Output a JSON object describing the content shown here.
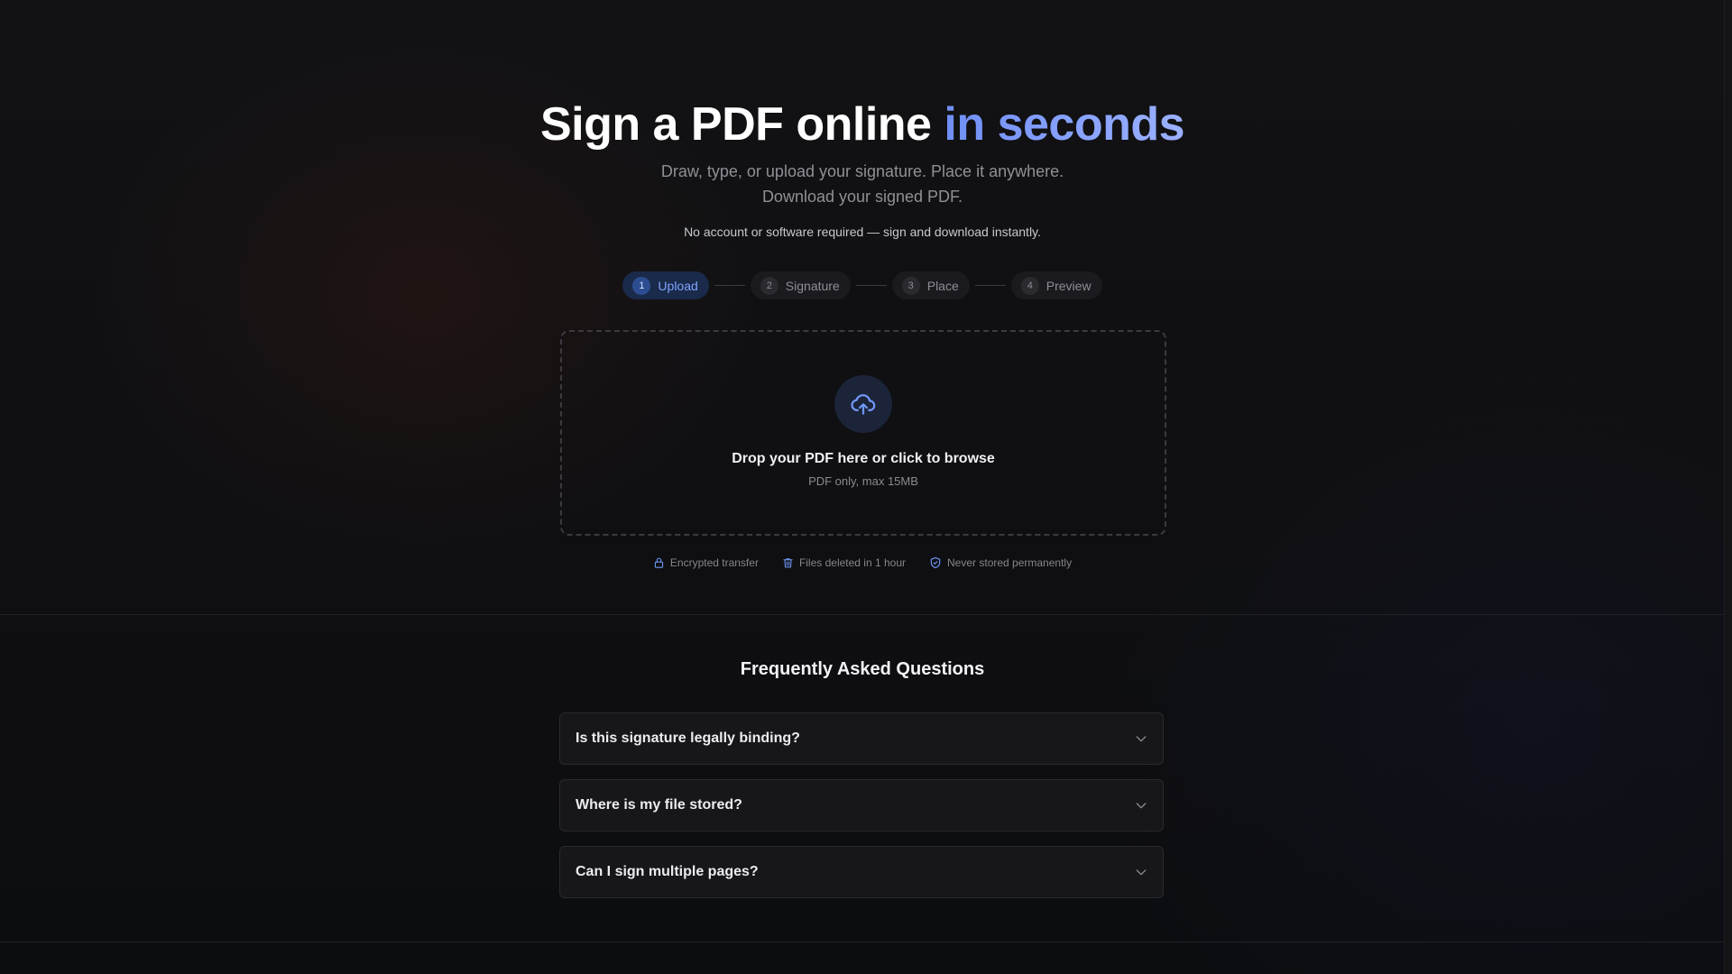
{
  "hero": {
    "title_main": "Sign a PDF online ",
    "title_accent": "in seconds",
    "subtitle_line1": "Draw, type, or upload your signature. Place it anywhere.",
    "subtitle_line2": "Download your signed PDF.",
    "note": "No account or software required — sign and download instantly."
  },
  "stepper": {
    "active_step": 1,
    "steps": [
      {
        "num": "1",
        "label": "Upload"
      },
      {
        "num": "2",
        "label": "Signature"
      },
      {
        "num": "3",
        "label": "Place"
      },
      {
        "num": "4",
        "label": "Preview"
      }
    ]
  },
  "dropzone": {
    "title": "Drop your PDF here or click to browse",
    "hint": "PDF only, max 15MB",
    "icon": "cloud-upload-icon"
  },
  "trust": [
    {
      "icon": "lock-icon",
      "label": "Encrypted transfer"
    },
    {
      "icon": "trash-icon",
      "label": "Files deleted in 1 hour"
    },
    {
      "icon": "shield-check-icon",
      "label": "Never stored permanently"
    }
  ],
  "faq": {
    "title": "Frequently Asked Questions",
    "items": [
      {
        "question": "Is this signature legally binding?"
      },
      {
        "question": "Where is my file stored?"
      },
      {
        "question": "Can I sign multiple pages?"
      }
    ]
  },
  "colors": {
    "accent": "#7fa3ff",
    "accent_gradient_start": "#6f8ff5",
    "background": "#111114"
  }
}
